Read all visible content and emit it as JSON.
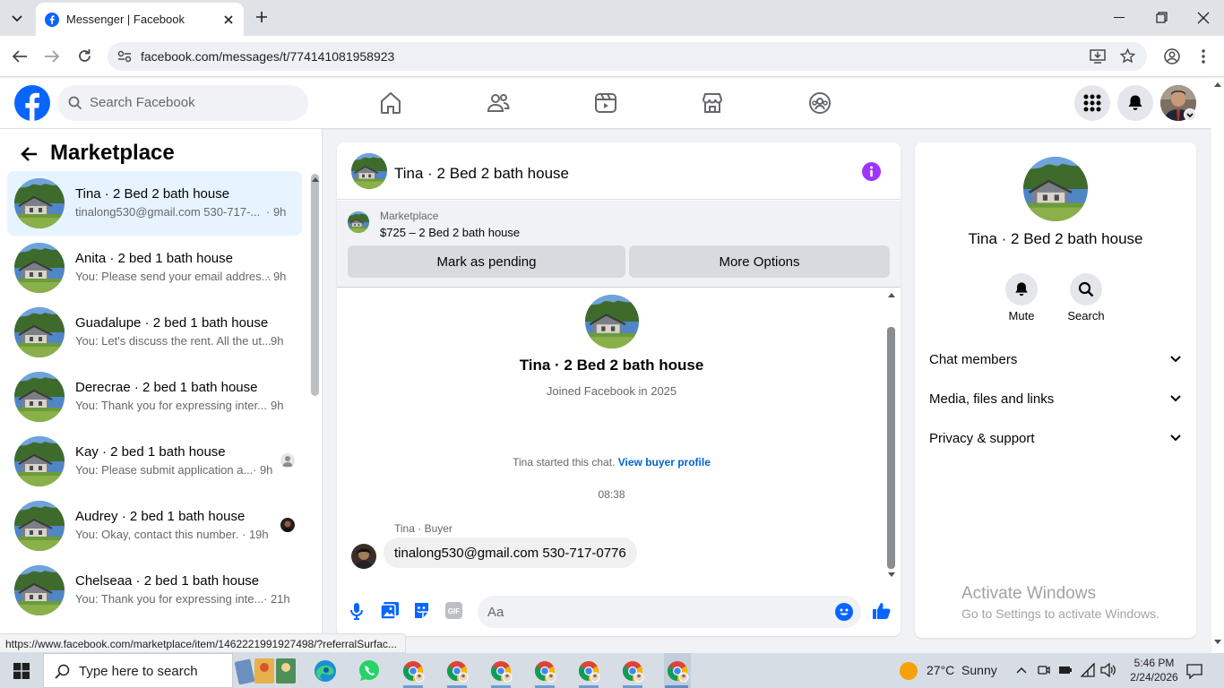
{
  "browser": {
    "tab_title": "Messenger | Facebook",
    "url": "facebook.com/messages/t/774141081958923",
    "status_url": "https://www.facebook.com/marketplace/item/1462221991927498/?referralSurfac..."
  },
  "header": {
    "search_placeholder": "Search Facebook"
  },
  "left_panel": {
    "title": "Marketplace",
    "conversations": [
      {
        "name": "Tina · 2 Bed 2 bath house",
        "preview": "tinalong530@gmail.com 530-717-...",
        "time": "· 9h"
      },
      {
        "name": "Anita · 2 bed 1 bath house",
        "preview": "You: Please send your email addres...",
        "time": "· 9h"
      },
      {
        "name": "Guadalupe · 2 bed 1 bath house",
        "preview": "You: Let's discuss the rent. All the ut...",
        "time": "9h"
      },
      {
        "name": "Derecrae · 2 bed 1 bath house",
        "preview": "You: Thank you for expressing inter...",
        "time": "9h"
      },
      {
        "name": "Kay · 2 bed 1 bath house",
        "preview": "You: Please submit application a...",
        "time": "· 9h"
      },
      {
        "name": "Audrey · 2 bed 1 bath house",
        "preview": "You: Okay, contact this number.",
        "time": "· 19h"
      },
      {
        "name": "Chelseaa · 2 bed 1 bath house",
        "preview": "You: Thank you for expressing inte...",
        "time": "· 21h"
      }
    ]
  },
  "chat": {
    "title": "Tina · 2 Bed 2 bath house",
    "marketplace_label": "Marketplace",
    "listing": "$725 – 2 Bed 2 bath house",
    "mark_pending": "Mark as pending",
    "more_options": "More Options",
    "profile_name": "Tina · 2 Bed 2 bath house",
    "joined": "Joined Facebook in 2025",
    "started_text": "Tina started this chat.",
    "view_profile": "View buyer profile",
    "timestamp": "08:38",
    "sender_label": "Tina · Buyer",
    "message": "tinalong530@gmail.com 530-717-0776",
    "input_placeholder": "Aa"
  },
  "info_panel": {
    "name": "Tina · 2 Bed 2 bath house",
    "mute": "Mute",
    "search": "Search",
    "sections": [
      "Chat members",
      "Media, files and links",
      "Privacy & support"
    ]
  },
  "watermark": {
    "line1": "Activate Windows",
    "line2": "Go to Settings to activate Windows."
  },
  "taskbar": {
    "search_placeholder": "Type here to search",
    "weather": "27°C  Sunny",
    "time": "5:46 PM",
    "date": "2/24/2026"
  },
  "colors": {
    "fb_blue": "#0866ff",
    "accent_purple": "#a033ff",
    "link_blue": "#0064d1"
  }
}
